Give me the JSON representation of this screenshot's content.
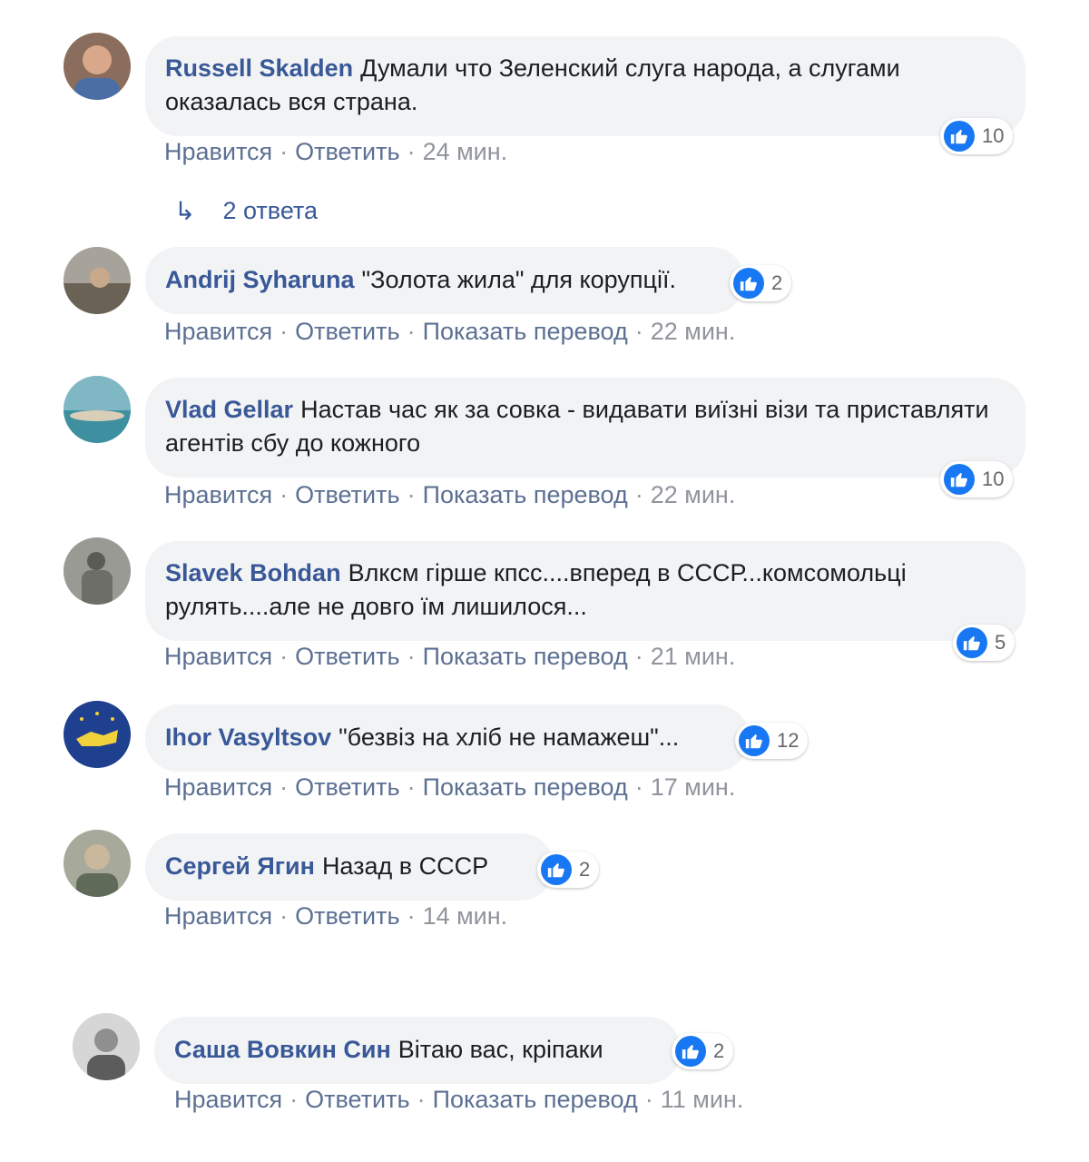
{
  "colors": {
    "author": "#385898",
    "bubble": "#f2f3f5",
    "like": "#1877f2",
    "meta": "#90949c"
  },
  "comments": [
    {
      "author": "Russell Skalden",
      "text": "Думали что Зеленский слуга народа, а слугами оказалась вся страна.",
      "likes": "10",
      "actions": [
        "Нравится",
        "Ответить"
      ],
      "time": "24 мин."
    },
    {
      "author": "Andrij Syharuna",
      "text": "\"Золота жила\" для корупції.",
      "likes": "2",
      "actions": [
        "Нравится",
        "Ответить",
        "Показать перевод"
      ],
      "time": "22 мин."
    },
    {
      "author": "Vlad Gellar",
      "text": "Настав час як за совка - видавати виїзні візи та приставляти агентів сбу до кожного",
      "likes": "10",
      "actions": [
        "Нравится",
        "Ответить",
        "Показать перевод"
      ],
      "time": "22 мин."
    },
    {
      "author": "Slavek Bohdan",
      "text": "Влксм гірше кпсс....вперед в СССР...комсомольці рулять....але не довго їм лишилося...",
      "likes": "5",
      "actions": [
        "Нравится",
        "Ответить",
        "Показать перевод"
      ],
      "time": "21 мин."
    },
    {
      "author": "Ihor Vasyltsov",
      "text": "\"безвіз на хліб не намажеш\"...",
      "likes": "12",
      "actions": [
        "Нравится",
        "Ответить",
        "Показать перевод"
      ],
      "time": "17 мин."
    },
    {
      "author": "Сергей Ягин",
      "text": "Назад в СССР",
      "likes": "2",
      "actions": [
        "Нравится",
        "Ответить"
      ],
      "time": "14 мин."
    },
    {
      "author": "Саша Вовкин Син",
      "text": "Вітаю вас, кріпаки",
      "likes": "2",
      "actions": [
        "Нравится",
        "Ответить",
        "Показать перевод"
      ],
      "time": "11 мин."
    }
  ],
  "replies_label": "2 ответа",
  "icons": {
    "like": "thumbs-up-icon",
    "reply": "reply-arrow-icon"
  }
}
